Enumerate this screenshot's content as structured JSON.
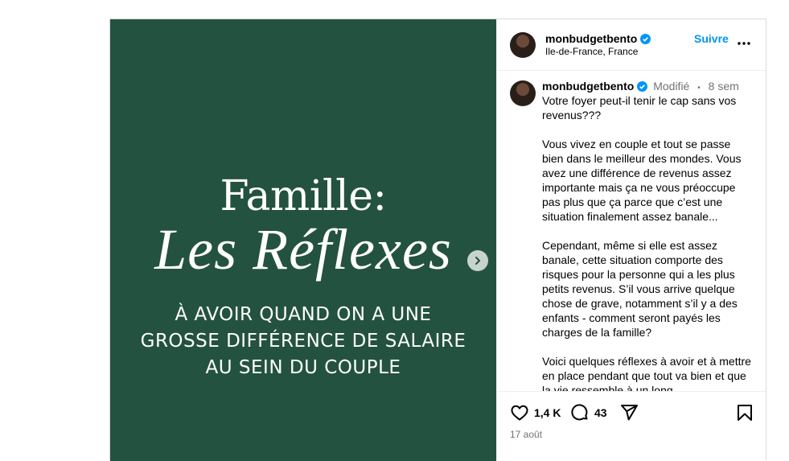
{
  "media": {
    "title": "Famille:",
    "script_title": "Les Réflexes",
    "subtitle_lines": [
      "À AVOIR QUAND ON A UNE",
      "GROSSE DIFFÉRENCE DE SALAIRE",
      "AU SEIN DU COUPLE"
    ],
    "background_color": "#245240"
  },
  "header": {
    "username": "monbudgetbento",
    "follow_label": "Suivre",
    "location": "Ile-de-France, France"
  },
  "caption": {
    "username": "monbudgetbento",
    "edited_label": "Modifié",
    "separator": "•",
    "time_ago": "8 sem",
    "text": "Votre foyer peut-il tenir le cap sans vos revenus???\n\nVous vivez en couple et tout se passe bien dans le meilleur des mondes. Vous avez une différence de revenus assez importante mais ça ne vous préoccupe pas plus que ça parce que c’est une situation finalement assez banale...\n\nCependant, même si elle est assez banale, cette situation comporte des risques pour la personne qui a les plus petits revenus. S’il vous arrive quelque chose de grave, notamment s’il y a des enfants - comment seront payés les charges de la famille?\n\nVoici quelques réflexes à avoir et à mettre en place pendant que tout va bien et que la vie ressemble à un long"
  },
  "actions": {
    "likes": "1,4 K",
    "comments": "43",
    "date": "17 août"
  },
  "colors": {
    "accent": "#0095f6",
    "verified": "#0095f6",
    "muted": "#737373"
  }
}
